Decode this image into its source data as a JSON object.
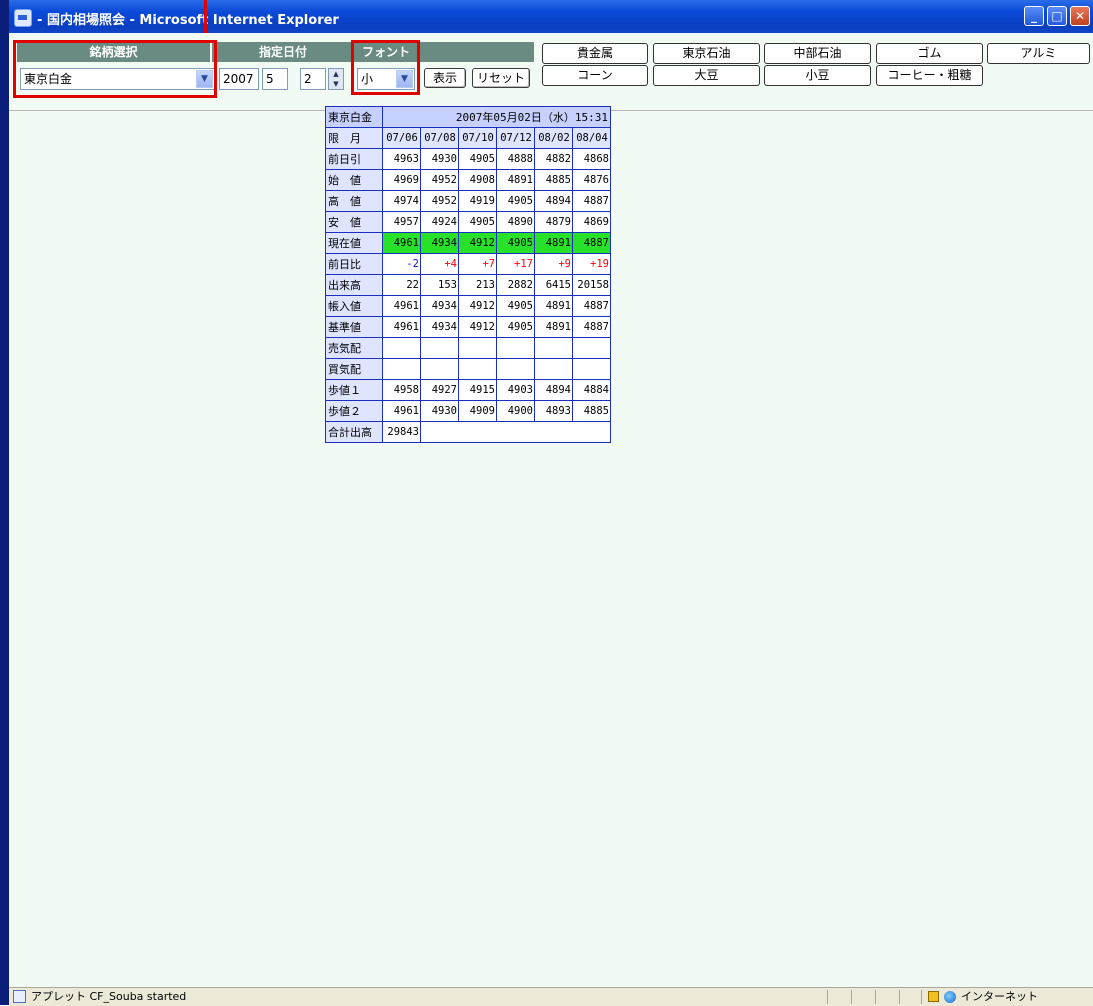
{
  "window": {
    "title": "国内相場照会 - Microsoft Internet Explorer",
    "title_prefix": "-",
    "controls": {
      "minimize": "_",
      "maximize": "□",
      "close": "✕"
    }
  },
  "toolbar": {
    "headers": {
      "brand": "銘柄選択",
      "date": "指定日付",
      "font": "フォント"
    },
    "brand_value": "東京白金",
    "year": "2007",
    "month": "5",
    "day": "2",
    "font_size": "小",
    "show_label": "表示",
    "reset_label": "リセット"
  },
  "nav": {
    "row1": [
      "貴金属",
      "東京石油",
      "中部石油",
      "ゴム",
      "アルミ"
    ],
    "row2": [
      "コーン",
      "大豆",
      "小豆",
      "コーヒー・粗糖"
    ]
  },
  "quote": {
    "name": "東京白金",
    "timestamp": "2007年05月02日（水）15:31",
    "month_label": "限　月",
    "months": [
      "07/06",
      "07/08",
      "07/10",
      "07/12",
      "08/02",
      "08/04"
    ],
    "rows": [
      {
        "label": "前日引",
        "values": [
          "4963",
          "4930",
          "4905",
          "4888",
          "4882",
          "4868"
        ]
      },
      {
        "label": "始　値",
        "values": [
          "4969",
          "4952",
          "4908",
          "4891",
          "4885",
          "4876"
        ]
      },
      {
        "label": "高　値",
        "values": [
          "4974",
          "4952",
          "4919",
          "4905",
          "4894",
          "4887"
        ]
      },
      {
        "label": "安　値",
        "values": [
          "4957",
          "4924",
          "4905",
          "4890",
          "4879",
          "4869"
        ]
      },
      {
        "label": "現在値",
        "values": [
          "4961",
          "4934",
          "4912",
          "4905",
          "4891",
          "4887"
        ]
      },
      {
        "label": "前日比",
        "values": [
          "-2",
          "+4",
          "+7",
          "+17",
          "+9",
          "+19"
        ]
      },
      {
        "label": "出来高",
        "values": [
          "22",
          "153",
          "213",
          "2882",
          "6415",
          "20158"
        ]
      },
      {
        "label": "帳入値",
        "values": [
          "4961",
          "4934",
          "4912",
          "4905",
          "4891",
          "4887"
        ]
      },
      {
        "label": "基準値",
        "values": [
          "4961",
          "4934",
          "4912",
          "4905",
          "4891",
          "4887"
        ]
      },
      {
        "label": "売気配",
        "values": [
          "",
          "",
          "",
          "",
          "",
          ""
        ]
      },
      {
        "label": "買気配",
        "values": [
          "",
          "",
          "",
          "",
          "",
          ""
        ]
      },
      {
        "label": "歩値１",
        "values": [
          "4958",
          "4927",
          "4915",
          "4903",
          "4894",
          "4884"
        ]
      },
      {
        "label": "歩値２",
        "values": [
          "4961",
          "4930",
          "4909",
          "4900",
          "4893",
          "4885"
        ]
      }
    ],
    "total_label": "合計出高",
    "total_value": "29843",
    "colors": {
      "current": "#28e22a",
      "negative": "#1010ff",
      "positive": "#ff0000"
    }
  },
  "status": {
    "text": "アプレット CF_Souba started",
    "zone": "インターネット"
  }
}
